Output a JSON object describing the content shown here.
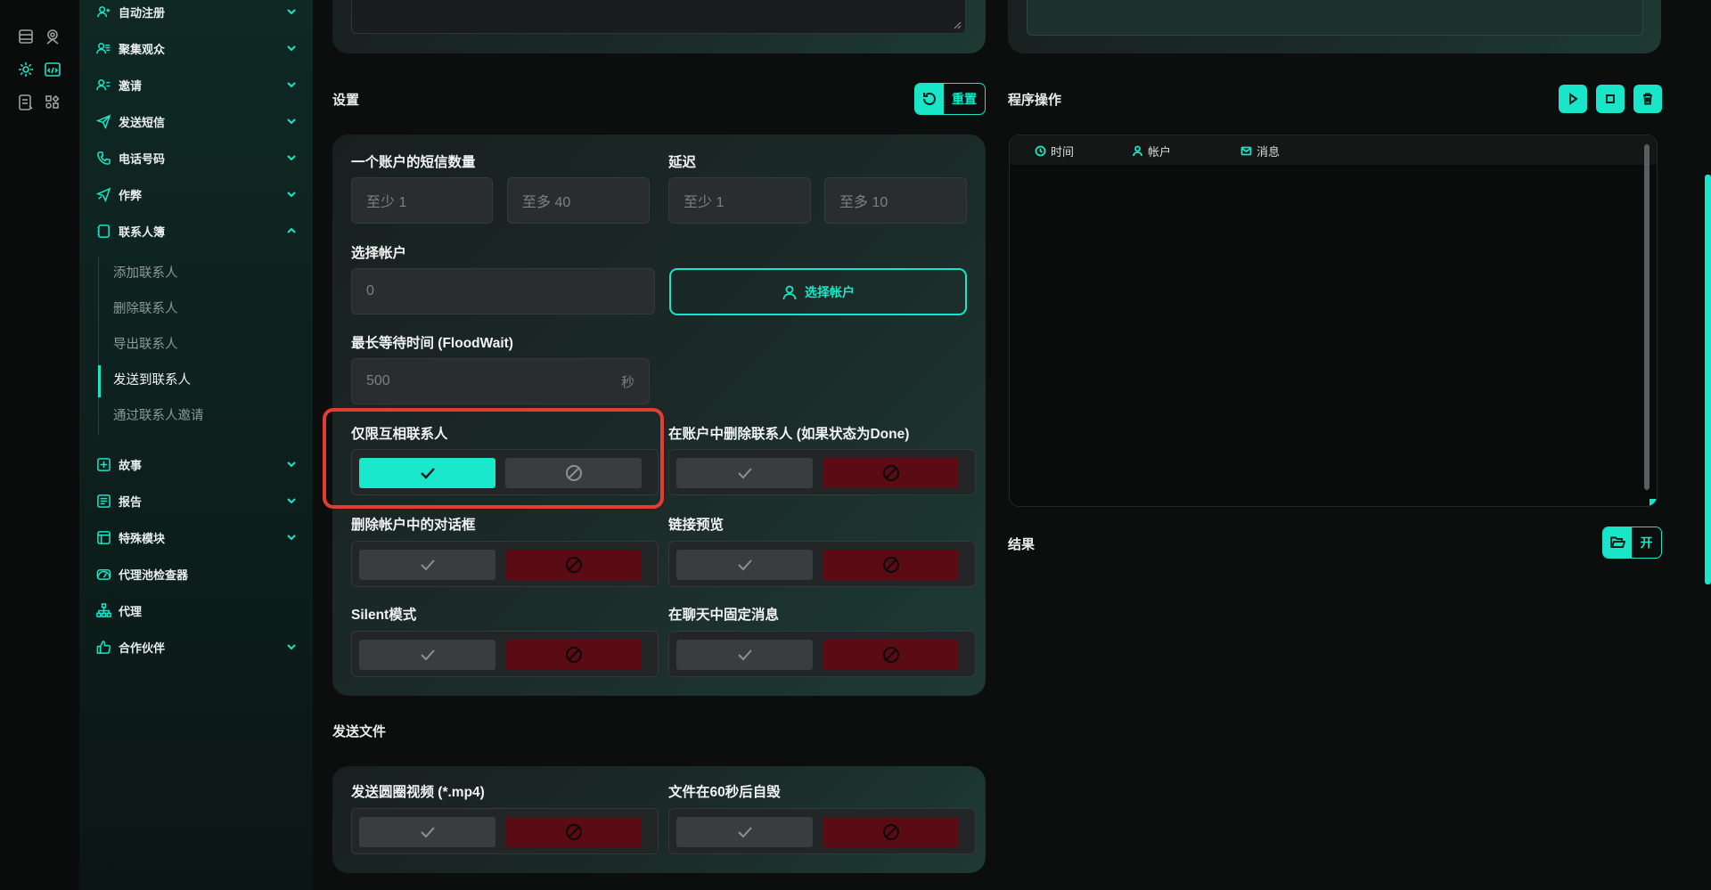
{
  "colors": {
    "accent": "#19e6c8",
    "danger": "#5a0b13",
    "highlight": "#e43b33",
    "background": "#0c0d0d"
  },
  "rail_icons": [
    "database-icon",
    "profile-icon",
    "gear-icon",
    "code-window-icon",
    "list-icon",
    "widgets-icon"
  ],
  "sidebar": {
    "items": [
      {
        "label": "自动注册",
        "icon": "user-plus-icon"
      },
      {
        "label": "聚集观众",
        "icon": "users-icon"
      },
      {
        "label": "邀请",
        "icon": "user-group-icon"
      },
      {
        "label": "发送短信",
        "icon": "send-icon"
      },
      {
        "label": "电话号码",
        "icon": "phone-icon"
      },
      {
        "label": "作弊",
        "icon": "send-cheat-icon"
      },
      {
        "label": "联系人簿",
        "icon": "contacts-book-icon"
      },
      {
        "label": "故事",
        "icon": "plus-square-icon"
      },
      {
        "label": "报告",
        "icon": "report-icon"
      },
      {
        "label": "特殊模块",
        "icon": "module-icon"
      },
      {
        "label": "代理池检查器",
        "icon": "gauge-icon"
      },
      {
        "label": "代理",
        "icon": "sitemap-icon"
      },
      {
        "label": "合作伙伴",
        "icon": "thumbs-up-icon"
      }
    ],
    "sub_items": [
      "添加联系人",
      "删除联系人",
      "导出联系人",
      "发送到联系人",
      "通过联系人邀请"
    ],
    "active_sub": "发送到联系人"
  },
  "settings": {
    "title": "设置",
    "reset_label": "重置",
    "sms_count_label": "一个账户的短信数量",
    "sms_min": "至少   1",
    "sms_max": "至多   40",
    "delay_label": "延迟",
    "delay_min": "至少   1",
    "delay_max": "至多   10",
    "select_account_label": "选择帐户",
    "account_count": "0",
    "select_account_button": "选择帐户",
    "floodwait_label": "最长等待时间 (FloodWait)",
    "floodwait_value": "500",
    "floodwait_unit": "秒",
    "mutual_only_label": "仅限互相联系人",
    "mutual_only_enabled": true,
    "delete_contacts_label": "在账户中删除联系人 (如果状态为Done)",
    "delete_contacts_enabled": false,
    "delete_dialogs_label": "删除帐户中的对话框",
    "delete_dialogs_enabled": false,
    "link_preview_label": "链接预览",
    "link_preview_enabled": false,
    "silent_label": "Silent模式",
    "silent_enabled": false,
    "pin_label": "在聊天中固定消息",
    "pin_enabled": false
  },
  "send_files": {
    "title": "发送文件",
    "round_video_label": "发送圆圈视频 (*.mp4)",
    "round_video_enabled": false,
    "self_destruct_label": "文件在60秒后自毁",
    "self_destruct_enabled": false
  },
  "program": {
    "title": "程序操作",
    "columns": [
      "时间",
      "帐户",
      "消息"
    ]
  },
  "results": {
    "title": "结果",
    "open_label": "开"
  }
}
